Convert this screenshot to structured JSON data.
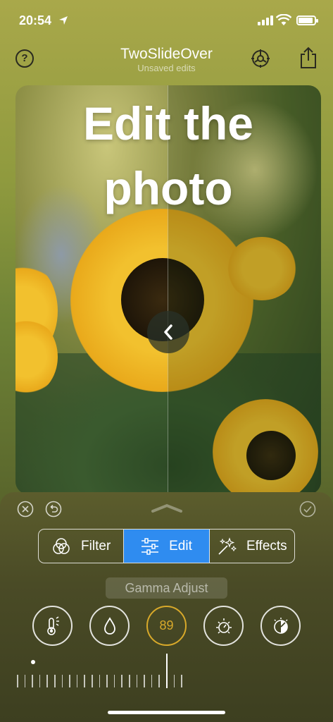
{
  "status_bar": {
    "time": "20:54"
  },
  "nav": {
    "help_label": "?",
    "title": "TwoSlideOver",
    "subtitle": "Unsaved edits"
  },
  "photo": {
    "headline_line1": "Edit the",
    "headline_line2": "photo"
  },
  "tabs": [
    {
      "label": "Filter",
      "icon": "filter-circles-icon",
      "active": false
    },
    {
      "label": "Edit",
      "icon": "sliders-icon",
      "active": true
    },
    {
      "label": "Effects",
      "icon": "sparkles-icon",
      "active": false
    }
  ],
  "adjustment": {
    "label": "Gamma Adjust",
    "value": "89"
  },
  "tools": [
    "temperature-icon",
    "tint-drop-icon",
    "gamma-value",
    "exposure-icon",
    "contrast-icon"
  ],
  "colors": {
    "accent_blue": "#2f8cf0",
    "value_gold": "#d8a92a"
  }
}
